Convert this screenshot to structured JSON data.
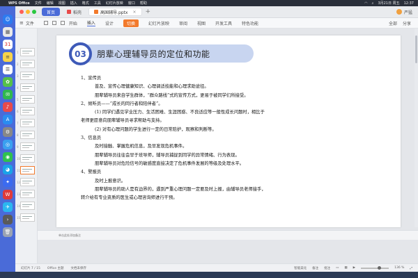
{
  "menubar": {
    "app": "WPS Office",
    "items": [
      "文件",
      "编辑",
      "视图",
      "插入",
      "格式",
      "工具",
      "幻灯片放映",
      "窗口",
      "帮助"
    ],
    "date": "3月21日 周五",
    "time": "12:37"
  },
  "tabs": {
    "home": "首页",
    "docer": "稻壳",
    "file": "高国辅导.pptx"
  },
  "user": "严猛",
  "ribbon": {
    "file_label": "文件",
    "tabs": [
      "开始",
      "插入",
      "设计",
      "切换",
      "幻灯片放映",
      "审阅",
      "视图",
      "开发工具",
      "特色功能"
    ],
    "selected": "切换",
    "right": [
      "全部",
      "分享"
    ]
  },
  "slide": {
    "number": "03",
    "title": "朋辈心理辅导员的定位和功能",
    "lines": [
      "1、宣传员",
      "普及、宣传心理健康知识、心理调适技能和心理求助途径。",
      "朋辈辅导员来自学生群体，“群众路线”式的宣传方式，更易于被同学们所接受。",
      "2、倾听员——“成长的同行者和陪伴者”。",
      "(1) 同学们遇见学业压力、生活困难、生涯困惑、不良适应等一般性成长问题时，相比于",
      "老师更愿意向朋辈辅导员寻求帮助与支持。",
      "(2) 对有心理问题的学生进行一定的日常陪护，观察和判断等。",
      "3、信息员",
      "及时接触、掌握危机信息，及早发现危机事件。",
      "朋辈辅导员往往会早于班导师，辅导员捕捉到同学的异常情绪、行为表现。",
      "朋辈辅导员对危险信号的敏感度直接决定了危机事件发展的等级及处理水平。",
      "4、警报员",
      "及时上报意识。",
      "朋辈辅导员的助人是有边界的，遇到严重心理问题一定要及时上报，由辅导员老师接手，",
      "转介给有专业资质的医生或心理咨询师进行干预。"
    ]
  },
  "notes_placeholder": "单击此处添加备注",
  "status": {
    "slide_count": "幻灯片 7 / 15",
    "theme": "Office 主题",
    "restore": "文档未保存",
    "smart": "智能美化",
    "notes": "备注",
    "comment": "批注",
    "zoom": "136 %"
  },
  "colors": {
    "accent_blue": "#3e5ab8",
    "title_band": "#c8d5f0",
    "ribbon_selected": "#f27a2c",
    "dock": "#4a6bd8"
  }
}
